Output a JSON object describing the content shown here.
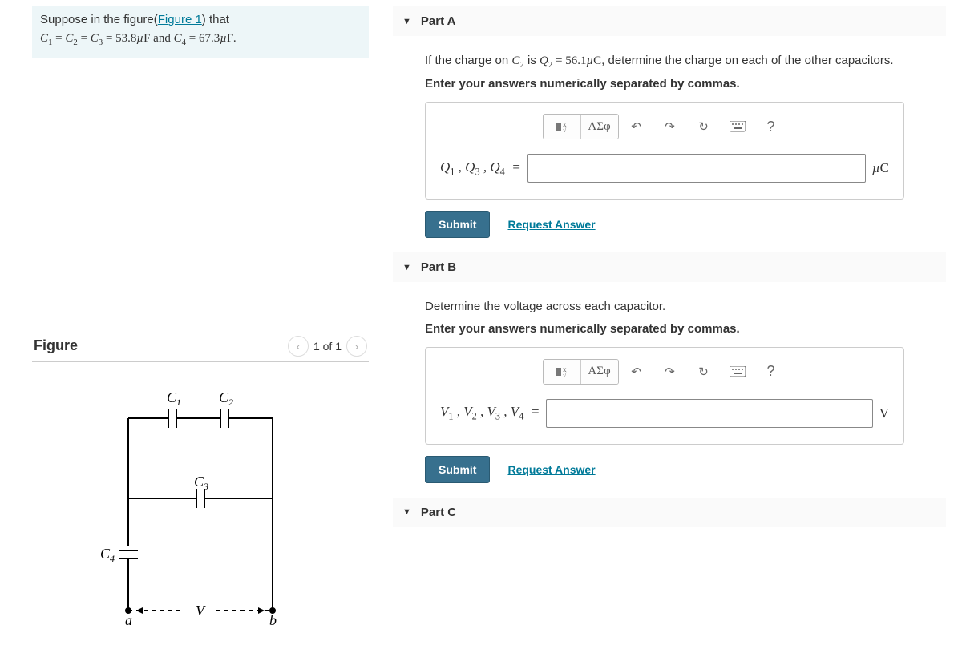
{
  "intro": {
    "line1_pre": "Suppose in the figure(",
    "figure_link": "Figure 1",
    "line1_post": ") that"
  },
  "given": {
    "c_equal_val": "53.8",
    "c_equal_unit": "µF",
    "c4_val": "67.3",
    "c4_unit": "µF"
  },
  "figure": {
    "title": "Figure",
    "pager": "1 of 1",
    "labels": {
      "c1": "C",
      "c2": "C",
      "c3": "C",
      "c4": "C",
      "a": "a",
      "b": "b",
      "v": "V"
    }
  },
  "partA": {
    "header": "Part A",
    "question_pre": "If the charge on ",
    "question_mid": " is ",
    "q2_val": "56.1",
    "q2_unit": "µC",
    "question_post": ", determine the charge on each of the other capacitors.",
    "instruction": "Enter your answers numerically separated by commas.",
    "lhs": "Q₁ , Q₃ , Q₄  =",
    "unit": "µC",
    "submit": "Submit",
    "request": "Request Answer"
  },
  "partB": {
    "header": "Part B",
    "question": "Determine the voltage across each capacitor.",
    "instruction": "Enter your answers numerically separated by commas.",
    "lhs": "V₁ , V₂ , V₃ , V₄  =",
    "unit": "V",
    "submit": "Submit",
    "request": "Request Answer"
  },
  "partC": {
    "header": "Part C"
  },
  "toolbar": {
    "greek": "ΑΣφ",
    "help": "?"
  }
}
